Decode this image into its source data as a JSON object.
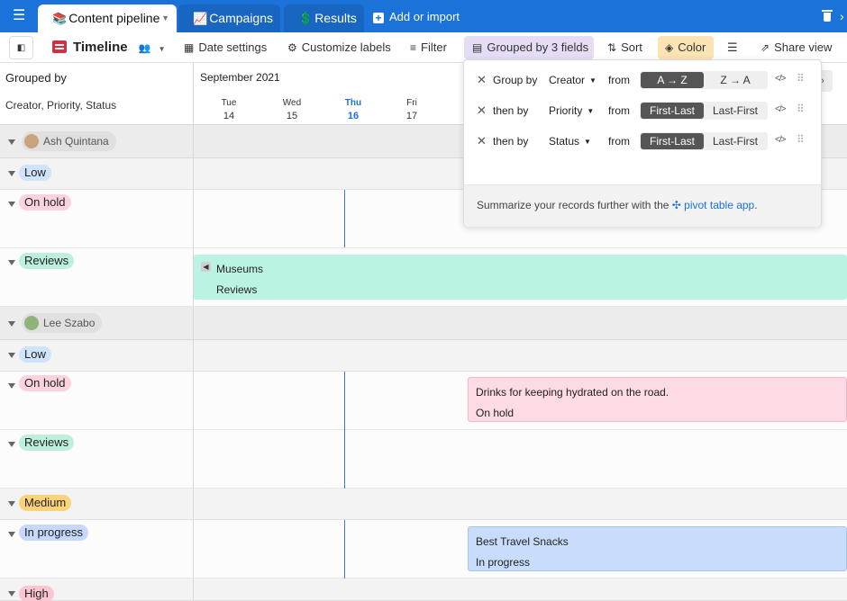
{
  "topbar": {
    "tabs": [
      {
        "emoji": "📚",
        "label": "Content pipeline",
        "active": true
      },
      {
        "emoji": "📈",
        "label": "Campaigns",
        "active": false
      },
      {
        "emoji": "💲",
        "label": "Results",
        "active": false
      }
    ],
    "add_import": "Add or import"
  },
  "toolbar": {
    "view_name": "Timeline",
    "date_settings": "Date settings",
    "customize_labels": "Customize labels",
    "filter": "Filter",
    "grouped": "Grouped by 3 fields",
    "sort": "Sort",
    "color": "Color",
    "share_view": "Share view"
  },
  "left_header": {
    "title": "Grouped by",
    "fields": "Creator, Priority, Status"
  },
  "timeline": {
    "month": "September 2021",
    "days": [
      {
        "name": "Tue",
        "num": "14",
        "today": false
      },
      {
        "name": "Wed",
        "num": "15",
        "today": false
      },
      {
        "name": "Thu",
        "num": "16",
        "today": true
      },
      {
        "name": "Fri",
        "num": "17",
        "today": false
      }
    ]
  },
  "groups": {
    "creator1": "Ash Quintana",
    "creator2": "Lee Szabo",
    "low": "Low",
    "on_hold": "On hold",
    "reviews": "Reviews",
    "medium": "Medium",
    "in_progress": "In progress",
    "high": "High"
  },
  "colors": {
    "low": "#cfe3fb",
    "on_hold": "#fbd3de",
    "reviews": "#bdf0dc",
    "medium": "#fcd37a",
    "in_progress": "#c6d8fb",
    "high": "#fbc6d2"
  },
  "records": {
    "museums_title": "Museums",
    "museums_status": "Reviews",
    "drinks_title": "Drinks for keeping hydrated on the road.",
    "drinks_status": "On hold",
    "snacks_title": "Best Travel Snacks",
    "snacks_status": "In progress"
  },
  "popover": {
    "rows": [
      {
        "label": "Group by",
        "field": "Creator",
        "from": "from",
        "opt1": "A → Z",
        "opt2": "Z → A"
      },
      {
        "label": "then by",
        "field": "Priority",
        "from": "from",
        "opt1": "First-Last",
        "opt2": "Last-First"
      },
      {
        "label": "then by",
        "field": "Status",
        "from": "from",
        "opt1": "First-Last",
        "opt2": "Last-First"
      }
    ],
    "footer_text": "Summarize your records further with the",
    "footer_link": "pivot table app",
    "footer_end": "."
  }
}
